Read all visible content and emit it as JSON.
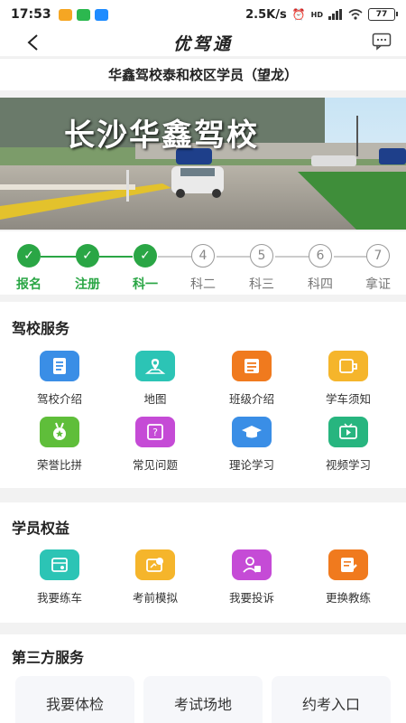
{
  "status_bar": {
    "time": "17:53",
    "network_speed": "2.5K/s",
    "signal": "HD",
    "battery": "77"
  },
  "nav": {
    "title": "优驾通"
  },
  "student_info": "华鑫驾校泰和校区学员（望龙）",
  "banner": {
    "title": "长沙华鑫驾校"
  },
  "progress": {
    "steps": [
      {
        "num": "✓",
        "label": "报名",
        "done": true
      },
      {
        "num": "✓",
        "label": "注册",
        "done": true
      },
      {
        "num": "✓",
        "label": "科一",
        "done": true
      },
      {
        "num": "4",
        "label": "科二",
        "done": false
      },
      {
        "num": "5",
        "label": "科三",
        "done": false
      },
      {
        "num": "6",
        "label": "科四",
        "done": false
      },
      {
        "num": "7",
        "label": "拿证",
        "done": false
      }
    ]
  },
  "school_services": {
    "title": "驾校服务",
    "items": [
      {
        "label": "驾校介绍",
        "icon": "document-icon"
      },
      {
        "label": "地图",
        "icon": "map-icon"
      },
      {
        "label": "班级介绍",
        "icon": "list-icon"
      },
      {
        "label": "学车须知",
        "icon": "notice-icon"
      },
      {
        "label": "荣誉比拼",
        "icon": "medal-icon"
      },
      {
        "label": "常见问题",
        "icon": "question-icon"
      },
      {
        "label": "理论学习",
        "icon": "graduation-cap-icon"
      },
      {
        "label": "视频学习",
        "icon": "video-icon"
      }
    ]
  },
  "student_rights": {
    "title": "学员权益",
    "items": [
      {
        "label": "我要练车",
        "icon": "calendar-icon"
      },
      {
        "label": "考前模拟",
        "icon": "simulate-icon"
      },
      {
        "label": "我要投诉",
        "icon": "complaint-icon"
      },
      {
        "label": "更换教练",
        "icon": "edit-icon"
      }
    ]
  },
  "third_party": {
    "title": "第三方服务",
    "items": [
      "我要体检",
      "考试场地",
      "约考入口"
    ]
  },
  "colors": {
    "green": "#2aa645",
    "blue": "#3a8ee6",
    "teal": "#2cc4b5",
    "orange": "#f07a1e",
    "yellow": "#f5b52b",
    "lime": "#5fbe3a",
    "magenta": "#c54bd6",
    "video_green": "#27b57f"
  }
}
